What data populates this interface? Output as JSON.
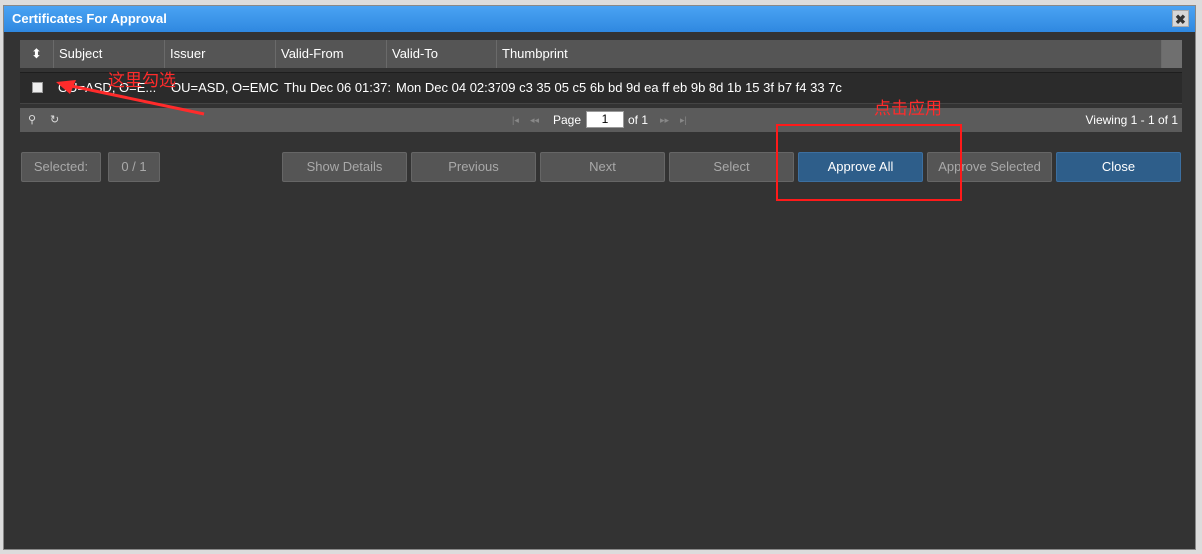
{
  "dialog": {
    "title": "Certificates For Approval",
    "close_glyph": "✖"
  },
  "grid": {
    "sort_glyph": "⬍",
    "columns": [
      "Subject",
      "Issuer",
      "Valid-From",
      "Valid-To",
      "Thumbprint"
    ],
    "rows": [
      {
        "subject": "OU=ASD, O=E...",
        "issuer": "OU=ASD, O=EMC",
        "valid_from": "Thu Dec 06 01:37:",
        "valid_to": "Mon Dec 04 02:37",
        "thumbprint": "09 c3 35 05 c5 6b bd 9d ea ff eb 9b 8d 1b 15 3f b7 f4 33 7c"
      }
    ]
  },
  "pager": {
    "search_glyph": "⚲",
    "refresh_glyph": "↻",
    "first_glyph": "|◂",
    "prev_glyph": "◂◂",
    "next_glyph": "▸▸",
    "last_glyph": "▸|",
    "page_label": "Page",
    "page_value": "1",
    "of_label": "of 1",
    "viewing": "Viewing 1 - 1 of 1"
  },
  "buttons": {
    "selected_label": "Selected:",
    "selected_count": "0 / 1",
    "show_details": "Show Details",
    "previous": "Previous",
    "next": "Next",
    "select": "Select",
    "approve_all": "Approve All",
    "approve_selected": "Approve Selected",
    "close": "Close"
  },
  "annotations": {
    "check_here": "这里勾选",
    "click_apply": "点击应用",
    "color": "#ff2b2b"
  }
}
